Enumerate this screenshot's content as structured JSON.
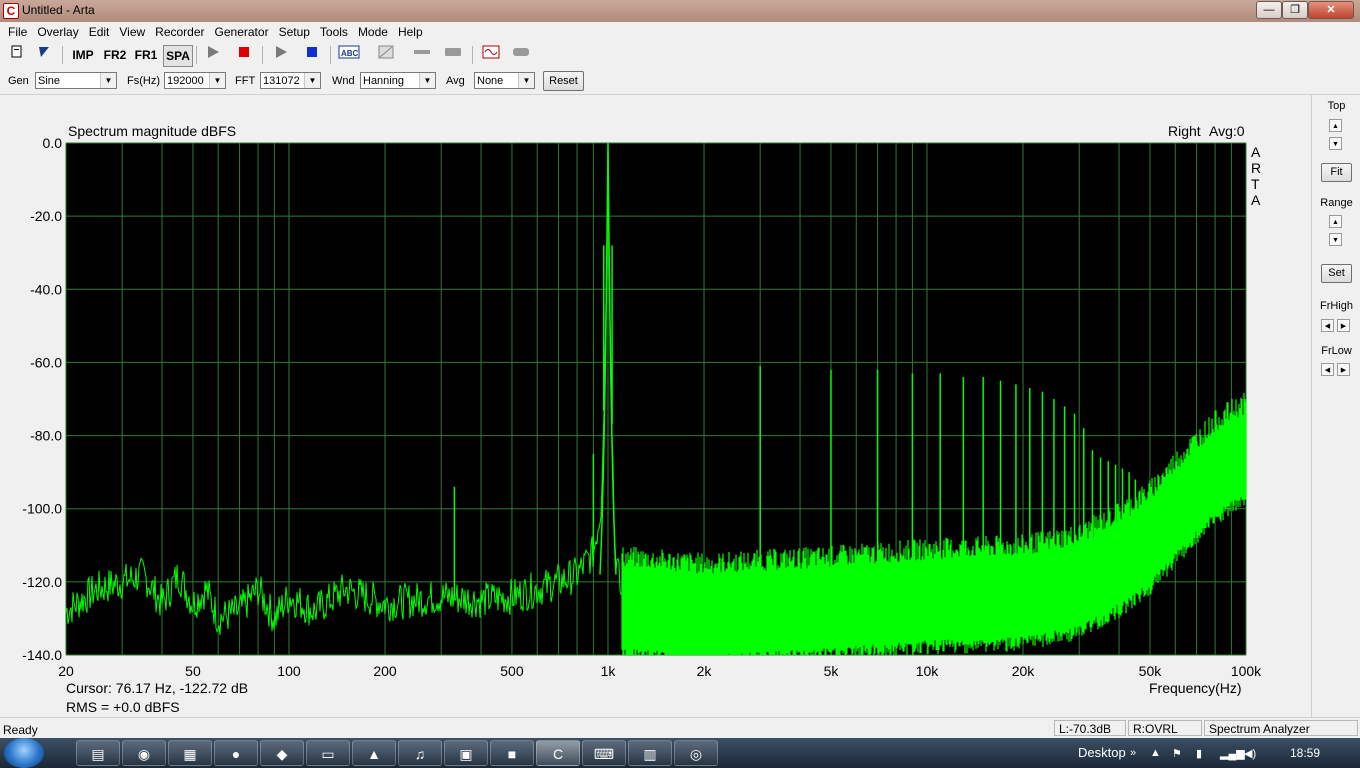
{
  "window": {
    "title": "Untitled - Arta",
    "app_icon": "C",
    "minimize": "—",
    "maximize": "❐",
    "close": "✕"
  },
  "menu": [
    "File",
    "Overlay",
    "Edit",
    "View",
    "Recorder",
    "Generator",
    "Setup",
    "Tools",
    "Mode",
    "Help"
  ],
  "toolbar": {
    "imp": "IMP",
    "fr2": "FR2",
    "fr1": "FR1",
    "spa": "SPA",
    "icons": [
      "new-icon",
      "open-icon",
      "imp-mode-icon",
      "fr2-mode-icon",
      "fr1-mode-icon",
      "spa-mode-icon",
      "play-icon",
      "stop-icon",
      "gen-play-icon",
      "gen-stop-icon",
      "abc-icon",
      "overlay-icon",
      "probe-icon",
      "bar-icon",
      "scope-icon",
      "rec-icon"
    ]
  },
  "settings": {
    "gen_label": "Gen",
    "gen_value": "Sine",
    "fs_label": "Fs(Hz)",
    "fs_value": "192000",
    "fft_label": "FFT",
    "fft_value": "131072",
    "wnd_label": "Wnd",
    "wnd_value": "Hanning",
    "avg_label": "Avg",
    "avg_value": "None",
    "reset": "Reset"
  },
  "right_panel": {
    "top": "Top",
    "fit": "Fit",
    "range": "Range",
    "set": "Set",
    "frhigh": "FrHigh",
    "frlow": "FrLow"
  },
  "chart_data": {
    "type": "line",
    "title": "Spectrum magnitude dBFS",
    "channel": "Right",
    "avg": "Avg:0",
    "watermark": [
      "A",
      "R",
      "T",
      "A"
    ],
    "xlabel": "Frequency(Hz)",
    "x_scale": "log",
    "xlim": [
      20,
      100000
    ],
    "ylim": [
      -140,
      0
    ],
    "yticks": [
      "0.0",
      "-20.0",
      "-40.0",
      "-60.0",
      "-80.0",
      "-100.0",
      "-120.0",
      "-140.0"
    ],
    "xticks": [
      {
        "v": 20,
        "t": "20"
      },
      {
        "v": 50,
        "t": "50"
      },
      {
        "v": 100,
        "t": "100"
      },
      {
        "v": 200,
        "t": "200"
      },
      {
        "v": 500,
        "t": "500"
      },
      {
        "v": 1000,
        "t": "1k"
      },
      {
        "v": 2000,
        "t": "2k"
      },
      {
        "v": 5000,
        "t": "5k"
      },
      {
        "v": 10000,
        "t": "10k"
      },
      {
        "v": 20000,
        "t": "20k"
      },
      {
        "v": 50000,
        "t": "50k"
      },
      {
        "v": 100000,
        "t": "100k"
      }
    ],
    "grid": true,
    "background": "#000000",
    "grid_color": "#2e7d32",
    "line_color": "#00ff00",
    "fundamental": {
      "x": 1000,
      "y": 0
    },
    "spurs": [
      {
        "x": 330,
        "y": -94
      },
      {
        "x": 865,
        "y": -114
      },
      {
        "x": 900,
        "y": -85
      },
      {
        "x": 970,
        "y": -28
      },
      {
        "x": 1030,
        "y": -28
      },
      {
        "x": 3000,
        "y": -61
      },
      {
        "x": 5000,
        "y": -62
      },
      {
        "x": 7000,
        "y": -62
      },
      {
        "x": 9000,
        "y": -63
      },
      {
        "x": 11000,
        "y": -63
      },
      {
        "x": 13000,
        "y": -64
      },
      {
        "x": 15000,
        "y": -64
      },
      {
        "x": 17000,
        "y": -65
      },
      {
        "x": 19000,
        "y": -66
      },
      {
        "x": 21000,
        "y": -67
      },
      {
        "x": 23000,
        "y": -68
      },
      {
        "x": 25000,
        "y": -70
      },
      {
        "x": 27000,
        "y": -72
      },
      {
        "x": 29000,
        "y": -74
      },
      {
        "x": 31000,
        "y": -78
      },
      {
        "x": 33000,
        "y": -84
      },
      {
        "x": 35000,
        "y": -86
      },
      {
        "x": 37000,
        "y": -87
      },
      {
        "x": 39000,
        "y": -88
      },
      {
        "x": 41000,
        "y": -89
      },
      {
        "x": 43000,
        "y": -90
      },
      {
        "x": 45000,
        "y": -92
      }
    ],
    "floor": [
      {
        "x": 20,
        "y": -128
      },
      {
        "x": 25,
        "y": -122
      },
      {
        "x": 30,
        "y": -120
      },
      {
        "x": 35,
        "y": -118
      },
      {
        "x": 40,
        "y": -126
      },
      {
        "x": 45,
        "y": -118
      },
      {
        "x": 50,
        "y": -126
      },
      {
        "x": 55,
        "y": -122
      },
      {
        "x": 60,
        "y": -130
      },
      {
        "x": 70,
        "y": -128
      },
      {
        "x": 80,
        "y": -122
      },
      {
        "x": 90,
        "y": -130
      },
      {
        "x": 100,
        "y": -124
      },
      {
        "x": 120,
        "y": -128
      },
      {
        "x": 150,
        "y": -122
      },
      {
        "x": 200,
        "y": -126
      },
      {
        "x": 300,
        "y": -124
      },
      {
        "x": 400,
        "y": -125
      },
      {
        "x": 500,
        "y": -124
      },
      {
        "x": 600,
        "y": -122
      },
      {
        "x": 700,
        "y": -120
      },
      {
        "x": 800,
        "y": -118
      },
      {
        "x": 900,
        "y": -112
      },
      {
        "x": 950,
        "y": -100
      },
      {
        "x": 980,
        "y": -60
      },
      {
        "x": 1000,
        "y": 0
      },
      {
        "x": 1020,
        "y": -60
      },
      {
        "x": 1050,
        "y": -110
      },
      {
        "x": 1100,
        "y": -124
      },
      {
        "x": 2000,
        "y": -126
      },
      {
        "x": 5000,
        "y": -124
      },
      {
        "x": 10000,
        "y": -122
      },
      {
        "x": 20000,
        "y": -121
      },
      {
        "x": 30000,
        "y": -118
      },
      {
        "x": 40000,
        "y": -112
      },
      {
        "x": 50000,
        "y": -106
      },
      {
        "x": 60000,
        "y": -98
      },
      {
        "x": 70000,
        "y": -92
      },
      {
        "x": 80000,
        "y": -87
      },
      {
        "x": 90000,
        "y": -84
      },
      {
        "x": 100000,
        "y": -82
      }
    ],
    "cursor": "Cursor: 76.17 Hz, -122.72 dB",
    "rms": "RMS =    +0.0 dBFS",
    "rms_color": "#c00000"
  },
  "status": {
    "ready": "Ready",
    "level": "L:-70.3dB",
    "ovrl": "R:OVRL",
    "mode": "Spectrum Analyzer"
  },
  "taskbar": {
    "apps": [
      "folder-icon",
      "media-player-icon",
      "calculator-icon",
      "opera-icon",
      "browser-icon",
      "window-icon",
      "pdf-icon",
      "winamp-icon",
      "audio-editor-icon",
      "red-app-icon",
      "arta-icon",
      "keyboard-icon",
      "notepad-icon",
      "control-icon"
    ],
    "desktop": "Desktop",
    "clock": "18:59"
  }
}
